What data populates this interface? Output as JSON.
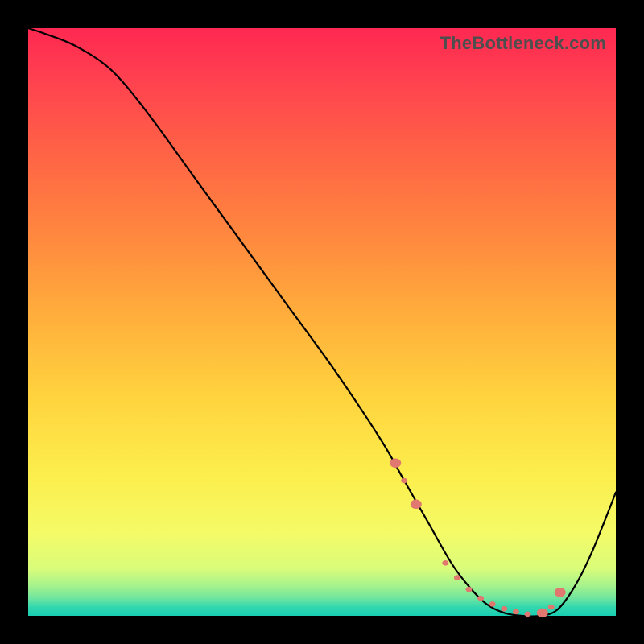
{
  "watermark": "TheBottleneck.com",
  "colors": {
    "page_bg": "#000000",
    "curve": "#000000",
    "markers": "#e0786f",
    "watermark_text": "#4e4e4e"
  },
  "chart_data": {
    "type": "line",
    "title": "",
    "xlabel": "",
    "ylabel": "",
    "xlim": [
      0,
      100
    ],
    "ylim": [
      0,
      100
    ],
    "legend": false,
    "grid": false,
    "x": [
      0,
      3,
      8,
      14,
      20,
      28,
      36,
      44,
      52,
      60,
      64,
      68,
      72,
      75,
      78,
      81,
      84,
      87,
      90,
      93,
      96,
      100
    ],
    "values": [
      100,
      99,
      97,
      93,
      86,
      75,
      64,
      53,
      42,
      30,
      23,
      16,
      9,
      5,
      2,
      0.5,
      0,
      0,
      1,
      5,
      11,
      21
    ],
    "annotations": {
      "markers_x": [
        62.5,
        64,
        66,
        71,
        73,
        75,
        77,
        79,
        81,
        83,
        85,
        87.5,
        89,
        90.5
      ],
      "markers_y": [
        26,
        23,
        19,
        9,
        6.5,
        4.5,
        3,
        2,
        1.2,
        0.7,
        0.3,
        0.5,
        1.5,
        4
      ],
      "marker_sizes": [
        7,
        4,
        7,
        4,
        4,
        4,
        4,
        4,
        4,
        4,
        4,
        7,
        4,
        7
      ]
    }
  }
}
